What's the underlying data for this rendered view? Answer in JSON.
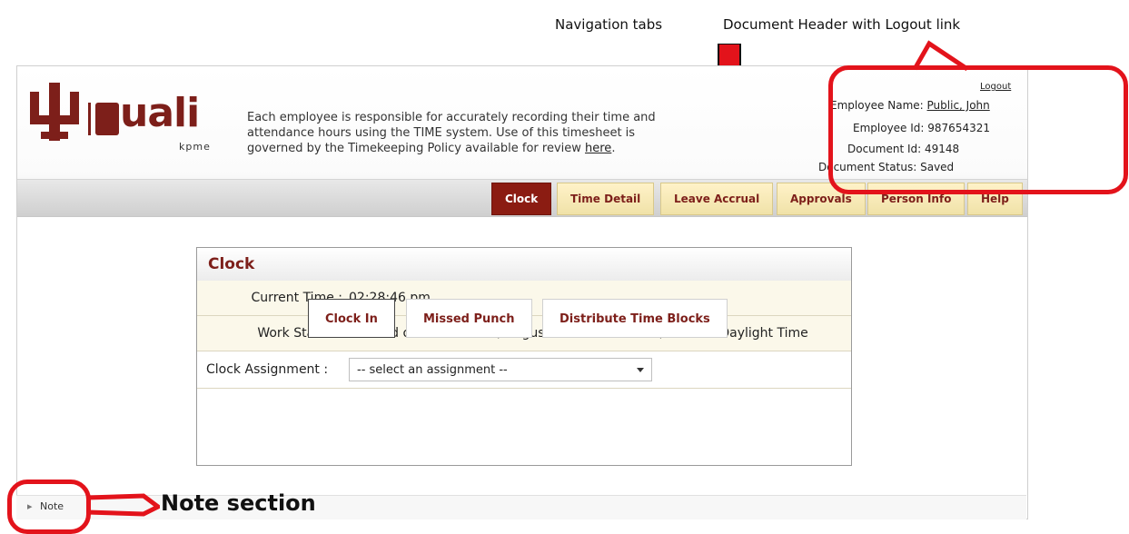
{
  "callouts": {
    "nav_tabs": "Navigation tabs",
    "doc_header": "Document Header with Logout link",
    "note_section": "Note section"
  },
  "brand": {
    "logo_word": "uali",
    "logo_sub": "kpme",
    "brand_color": "#7d1f1a"
  },
  "intro": {
    "text": "Each employee is responsible for accurately recording their time and attendance hours using the TIME system. Use of this timesheet is governed by the Timekeeping Policy available for review ",
    "link": "here",
    "end": "."
  },
  "header_info": {
    "logout": "Logout",
    "employee_name_label": "Employee Name:",
    "employee_name": "Public, John",
    "employee_id_label": "Employee Id:",
    "employee_id": "987654321",
    "document_id_label": "Document Id:",
    "document_id": "49148",
    "document_status_label": "Document Status:",
    "document_status": "Saved"
  },
  "tabs": [
    {
      "label": "Clock",
      "active": true
    },
    {
      "label": "Time Detail"
    },
    {
      "label": "Leave Accrual"
    },
    {
      "label": "Approvals"
    },
    {
      "label": "Person Info"
    },
    {
      "label": "Help"
    }
  ],
  "clock": {
    "title": "Clock",
    "current_time_label": "Current Time :",
    "current_time": "02:28:46 pm",
    "work_status_label": "Work Status :",
    "work_status": "Clocked out since : Thu, August 25 2011   5:27:49, Eastern Daylight Time",
    "assignment_label": "Clock Assignment :",
    "assignment_value": "-- select an assignment --"
  },
  "buttons": {
    "clock_in": "Clock In",
    "missed_punch": "Missed Punch",
    "distribute": "Distribute Time Blocks"
  },
  "note": {
    "label": "Note"
  },
  "colors": {
    "highlight": "#e3131b",
    "tab_active": "#8b1c12",
    "tab_bg": "#f0e2a8"
  }
}
